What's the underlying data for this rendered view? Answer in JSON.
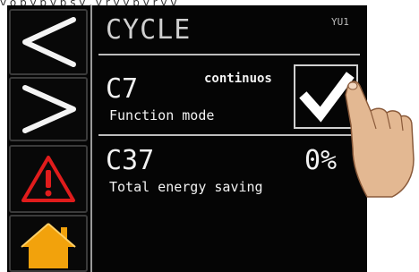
{
  "caption_fragment": "y o p y p y p s   y ,   y r y y p y r y v",
  "screen": {
    "title": "CYCLE",
    "screen_id": "YU1"
  },
  "side_buttons": [
    {
      "name": "back",
      "icon": "chevron-left-icon"
    },
    {
      "name": "forward",
      "icon": "chevron-right-icon"
    },
    {
      "name": "alarm",
      "icon": "warning-triangle-icon",
      "color": "#e01c1c"
    },
    {
      "name": "home",
      "icon": "home-icon",
      "color": "#f2a20c"
    }
  ],
  "params": [
    {
      "code": "C7",
      "label": "Function mode",
      "value": "continuos"
    },
    {
      "code": "C37",
      "label": "Total energy saving",
      "value": "0%"
    }
  ],
  "confirm": {
    "icon": "checkmark-icon"
  },
  "colors": {
    "panel": "#050505",
    "text": "#f2f2f2",
    "title": "#cfcfcf",
    "alarm": "#e01c1c",
    "home": "#f2a20c"
  }
}
